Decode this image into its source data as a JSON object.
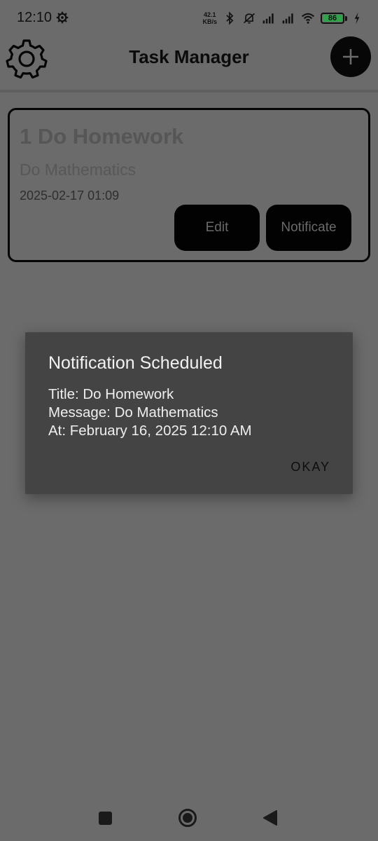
{
  "status_bar": {
    "time": "12:10",
    "net_speed_value": "42.1",
    "net_speed_unit": "KB/s",
    "battery_level": "86",
    "icons": [
      "settings-gear-icon",
      "bluetooth-icon",
      "mute-icon",
      "signal-icon",
      "signal-icon",
      "wifi-icon",
      "battery-icon",
      "charging-icon"
    ]
  },
  "app_bar": {
    "title": "Task Manager",
    "settings_icon": "gear-icon",
    "add_icon": "plus-icon"
  },
  "task": {
    "title": "1 Do Homework",
    "message": "Do Mathematics",
    "datetime": "2025-02-17 01:09",
    "edit_label": "Edit",
    "notificate_label": "Notificate"
  },
  "dialog": {
    "title": "Notification Scheduled",
    "lines": [
      "Title: Do Homework",
      "Message: Do Mathematics",
      "At: February 16, 2025 12:10 AM"
    ],
    "ok_label": "OKAY"
  },
  "nav_bar": {
    "icons": [
      "recents-square-icon",
      "home-circle-icon",
      "back-triangle-icon"
    ]
  },
  "colors": {
    "scrim_background": "#6b6b6b",
    "dialog_background": "#444444",
    "button_background": "#020202",
    "battery_green": "#2fa24a"
  }
}
